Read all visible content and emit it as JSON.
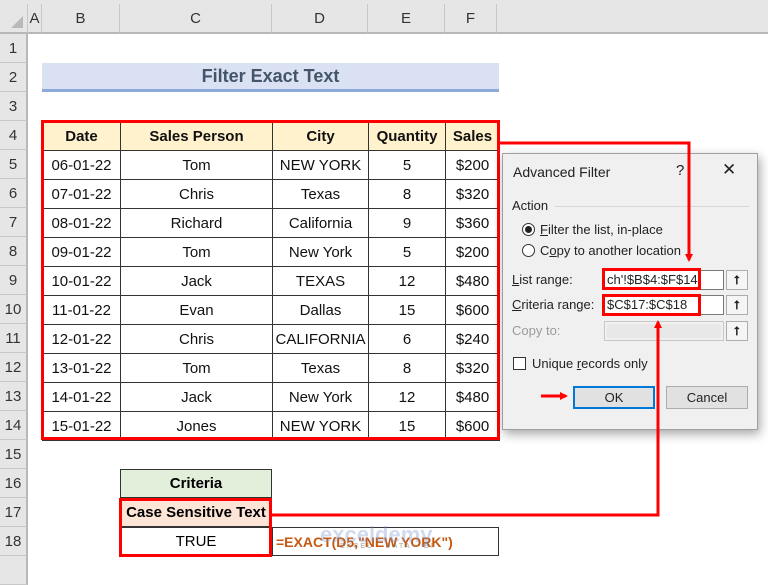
{
  "sheet": {
    "columns": [
      "A",
      "B",
      "C",
      "D",
      "E",
      "F"
    ],
    "rows": [
      "1",
      "2",
      "3",
      "4",
      "5",
      "6",
      "7",
      "8",
      "9",
      "10",
      "11",
      "12",
      "13",
      "14",
      "15",
      "16",
      "17",
      "18"
    ],
    "title": "Filter Exact Text",
    "table": {
      "headers": [
        "Date",
        "Sales Person",
        "City",
        "Quantity",
        "Sales"
      ],
      "rows": [
        [
          "06-01-22",
          "Tom",
          "NEW YORK",
          "5",
          "$200"
        ],
        [
          "07-01-22",
          "Chris",
          "Texas",
          "8",
          "$320"
        ],
        [
          "08-01-22",
          "Richard",
          "California",
          "9",
          "$360"
        ],
        [
          "09-01-22",
          "Tom",
          "New York",
          "5",
          "$200"
        ],
        [
          "10-01-22",
          "Jack",
          "TEXAS",
          "12",
          "$480"
        ],
        [
          "11-01-22",
          "Evan",
          "Dallas",
          "15",
          "$600"
        ],
        [
          "12-01-22",
          "Chris",
          "CALIFORNIA",
          "6",
          "$240"
        ],
        [
          "13-01-22",
          "Tom",
          "Texas",
          "8",
          "$320"
        ],
        [
          "14-01-22",
          "Jack",
          "New York",
          "12",
          "$480"
        ],
        [
          "15-01-22",
          "Jones",
          "NEW YORK",
          "15",
          "$600"
        ]
      ]
    },
    "criteria": {
      "header": "Criteria",
      "subheader": "Case Sensitive Text",
      "value": "TRUE",
      "formula": "=EXACT(D5,\"NEW YORK\")"
    },
    "watermark": {
      "brand": "exceldemy",
      "tagline": "EXCEL · DATA · BI"
    }
  },
  "dialog": {
    "title": "Advanced Filter",
    "help": "?",
    "close": "✕",
    "action_label": "Action",
    "option_filter_pre": "F",
    "option_filter_rest": "ilter the list, in-place",
    "option_copy_pre": "C",
    "option_copy_u": "o",
    "option_copy_rest": "py to another location",
    "list_range_u": "L",
    "list_range_rest": "ist range:",
    "list_range_value": "ch'!$B$4:$F$14",
    "criteria_range_u": "C",
    "criteria_range_rest": "riteria range:",
    "criteria_range_value": "$C$17:$C$18",
    "copy_to_label": "Copy to:",
    "copy_to_value": "",
    "unique_pre": "Unique ",
    "unique_u": "r",
    "unique_rest": "ecords only",
    "unique_checked": false,
    "selected_action": "filter-in-place",
    "ok_label": "OK",
    "cancel_label": "Cancel",
    "collapse_glyph": "⭡"
  },
  "annotation_color": "#ff0000"
}
